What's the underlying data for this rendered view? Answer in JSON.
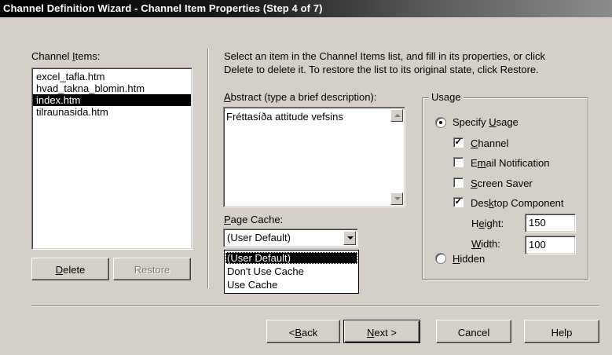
{
  "window": {
    "title": "Channel Definition Wizard - Channel Item Properties (Step 4 of 7)"
  },
  "items_panel": {
    "label_pre": "Channel ",
    "label_accel": "I",
    "label_post": "tems:",
    "items": [
      "excel_tafla.htm",
      "hvad_takna_blomin.htm",
      "index.htm",
      "tilraunasida.htm"
    ],
    "selected_index": 2,
    "delete_accel": "D",
    "delete_rest": "elete",
    "restore_label": "Restore"
  },
  "instructions": {
    "line1": "Select an item in the Channel Items list, and fill in its properties, or click",
    "line2": "Delete to delete it.  To restore the list to its original state, click Restore."
  },
  "abstract": {
    "label_accel": "A",
    "label_rest": "bstract (type a brief description):",
    "value": "Fréttasíða attitude vefsins"
  },
  "page_cache": {
    "label_accel": "P",
    "label_rest": "age Cache:",
    "selected": "(User Default)",
    "options": [
      "(User Default)",
      "Don't Use Cache",
      "Use Cache"
    ],
    "highlighted_index": 0
  },
  "usage": {
    "group_label": "Usage",
    "specify_pre": "Specify ",
    "specify_accel": "U",
    "specify_post": "sage",
    "specify_selected": true,
    "channel_accel": "C",
    "channel_rest": "hannel",
    "channel_checked": true,
    "email_pre": "E",
    "email_accel": "m",
    "email_rest": "ail Notification",
    "email_checked": false,
    "screen_accel": "S",
    "screen_rest": "creen Saver",
    "screen_checked": false,
    "desktop_pre": "Des",
    "desktop_accel": "k",
    "desktop_rest": "top Component",
    "desktop_checked": true,
    "height_pre": "H",
    "height_accel": "e",
    "height_rest": "ight:",
    "height_value": "150",
    "width_accel": "W",
    "width_rest": "idth:",
    "width_value": "100",
    "hidden_accel": "H",
    "hidden_rest": "idden",
    "hidden_selected": false
  },
  "footer": {
    "back_pre": "< ",
    "back_accel": "B",
    "back_rest": "ack",
    "next_accel": "N",
    "next_rest": "ext >",
    "cancel_label": "Cancel",
    "help_label": "Help"
  },
  "colors": {
    "title_bar": "#000000",
    "face": "#d4d0c8",
    "selection": "#000000"
  },
  "icons": {
    "check": "check-mark-icon",
    "scroll_up": "scroll-up-arrow-icon",
    "scroll_down": "scroll-down-arrow-icon",
    "dropdown": "dropdown-arrow-icon"
  }
}
